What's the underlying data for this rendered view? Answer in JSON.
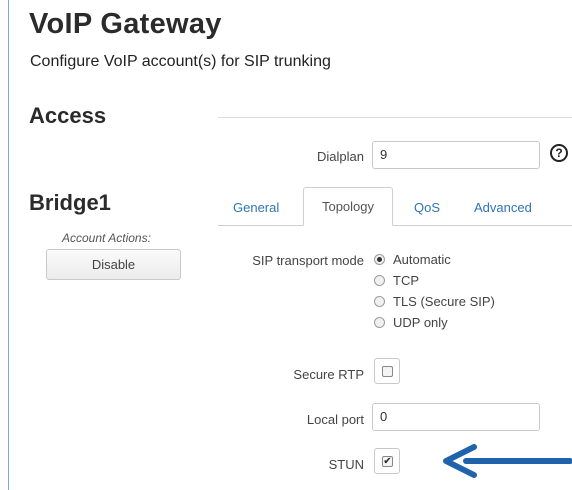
{
  "header": {
    "title": "VoIP Gateway",
    "subtitle": "Configure VoIP account(s) for SIP trunking"
  },
  "access": {
    "heading": "Access",
    "dialplan_label": "Dialplan",
    "dialplan_value": "9",
    "help_glyph": "?"
  },
  "account": {
    "name": "Bridge1",
    "actions_label": "Account Actions:",
    "disable_label": "Disable"
  },
  "tabs": [
    {
      "label": "General",
      "active": false
    },
    {
      "label": "Topology",
      "active": true
    },
    {
      "label": "QoS",
      "active": false
    },
    {
      "label": "Advanced",
      "active": false
    }
  ],
  "topology": {
    "transport_label": "SIP transport mode",
    "transport_options": [
      {
        "label": "Automatic",
        "selected": true
      },
      {
        "label": "TCP",
        "selected": false
      },
      {
        "label": "TLS (Secure SIP)",
        "selected": false
      },
      {
        "label": "UDP only",
        "selected": false
      }
    ],
    "secure_rtp_label": "Secure RTP",
    "secure_rtp_checked": false,
    "local_port_label": "Local port",
    "local_port_value": "0",
    "stun_label": "STUN",
    "stun_checked": true,
    "check_glyph": "✔"
  },
  "colors": {
    "accent": "#2e75b6",
    "annotation_arrow": "#1f63ad"
  }
}
